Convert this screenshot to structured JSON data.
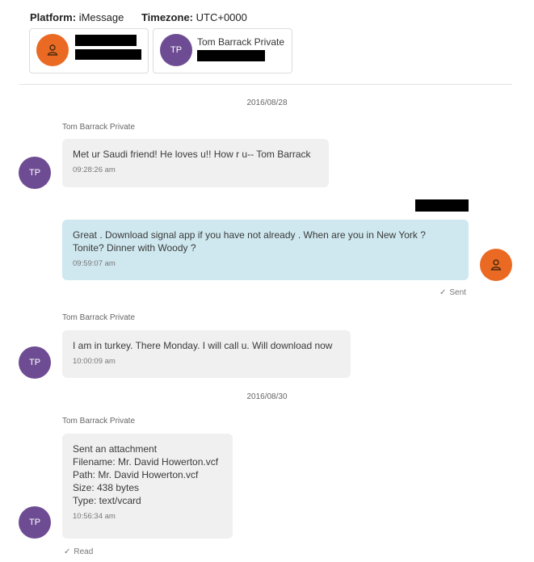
{
  "header": {
    "platform_label": "Platform:",
    "platform_value": "iMessage",
    "timezone_label": "Timezone:",
    "timezone_value": "UTC+0000"
  },
  "participants": [
    {
      "avatar": "user-icon",
      "name": ""
    },
    {
      "avatar": "TP",
      "name": "Tom Barrack Private"
    }
  ],
  "messages": [
    {
      "date": "2016/08/28"
    },
    {
      "sender": "Tom Barrack Private",
      "avatar": "TP",
      "lines": [
        "Met ur Saudi friend!  He loves u!! How r u-- Tom Barrack"
      ],
      "time": "09:28:26 am"
    },
    {
      "lines": [
        "Great .  Download signal app if you have not already .  When are you in New York ?",
        "Tonite? Dinner with Woody ?"
      ],
      "time": "09:59:07 am",
      "status": "Sent"
    },
    {
      "sender": "Tom Barrack Private",
      "avatar": "TP",
      "lines": [
        "I am in turkey. There Monday. I will call u. Will download now"
      ],
      "time": "10:00:09 am"
    },
    {
      "date": "2016/08/30"
    },
    {
      "sender": "Tom Barrack Private",
      "avatar": "TP",
      "lines": [
        "Sent an attachment",
        "Filename: Mr. David Howerton.vcf",
        "Path: Mr. David Howerton.vcf",
        "Size: 438 bytes",
        "Type: text/vcard"
      ],
      "time": "10:56:34 am",
      "status": "Read"
    }
  ],
  "colors": {
    "avatar_tp": "#6e4c93",
    "avatar_me": "#ea6a24",
    "bubble_in": "#f1f0f0",
    "bubble_out": "#cfe8ef"
  }
}
